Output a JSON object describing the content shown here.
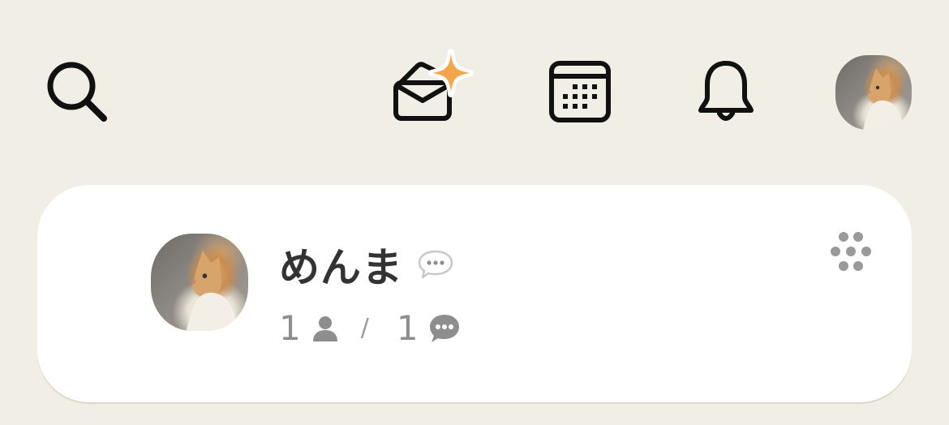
{
  "topbar": {
    "icons": {
      "search": "search-icon",
      "mail": "mail-sparkle-icon",
      "calendar": "calendar-icon",
      "bell": "bell-icon",
      "avatar": "profile-avatar"
    },
    "sparkle_color": "#f5a64a"
  },
  "card": {
    "title": "めんま",
    "member_count": "1",
    "separator": "/",
    "comment_count": "1",
    "more_icon": "dots-cluster-icon"
  }
}
